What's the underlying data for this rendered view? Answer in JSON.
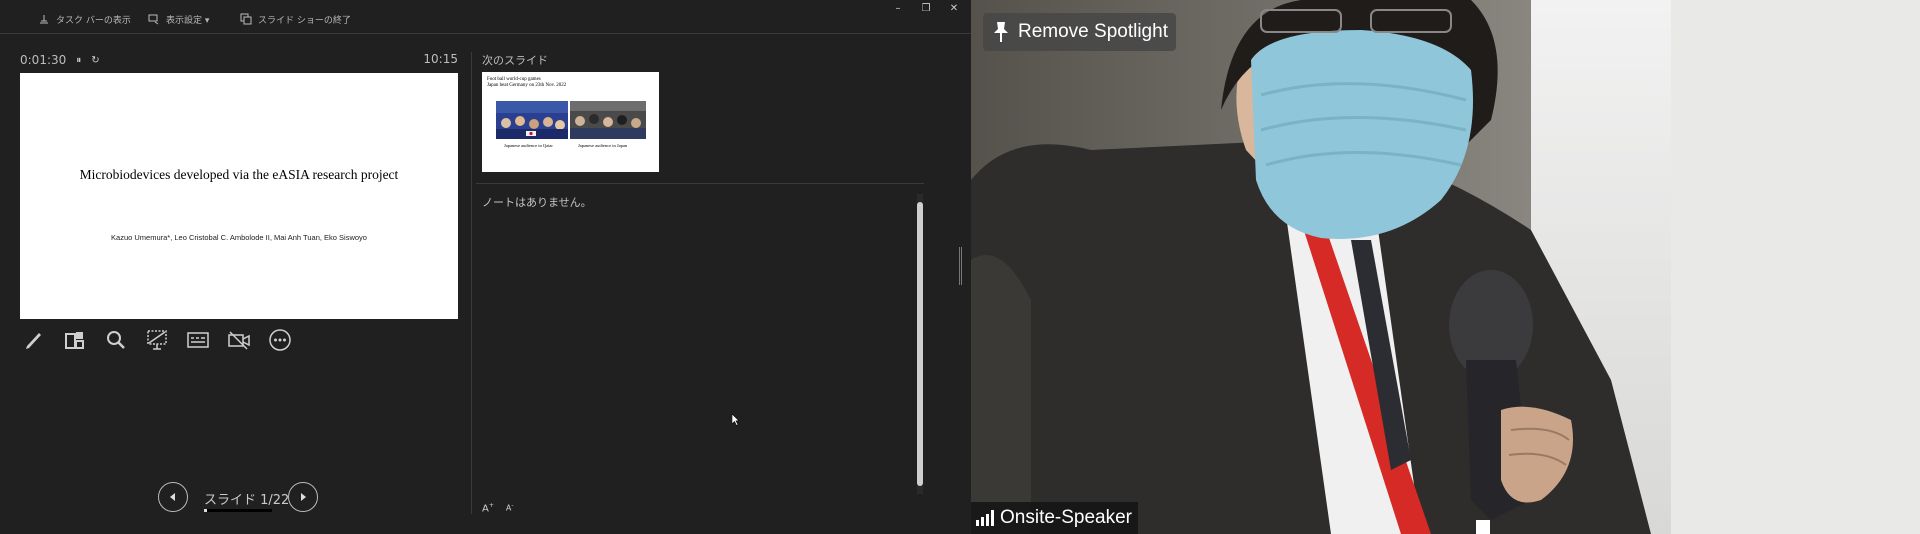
{
  "topbar": {
    "items": [
      {
        "label": "タスク バーの表示",
        "icon": "taskbar-icon"
      },
      {
        "label": "表示設定 ▾",
        "icon": "display-settings-icon"
      },
      {
        "label": "スライド ショーの終了",
        "icon": "end-slideshow-icon"
      }
    ],
    "window_controls": [
      "minimize-icon",
      "restore-icon",
      "close-icon"
    ]
  },
  "timer": {
    "elapsed": "0:01:30",
    "pause_glyph": "⏸",
    "reset_glyph": "↻",
    "clock": "10:15"
  },
  "current_slide": {
    "title": "Microbiodevices developed via the eASIA research project",
    "authors": "Kazuo Umemura*, Leo Cristobal C. Ambolode II, Mai Anh Tuan, Eko Siswoyo"
  },
  "tools": [
    "pen-icon",
    "all-slides-icon",
    "zoom-icon",
    "black-screen-icon",
    "subtitles-icon",
    "camera-off-icon",
    "more-options-icon"
  ],
  "navigation": {
    "counter": "スライド 1/22",
    "progress": 0.045
  },
  "next_slide": {
    "label": "次のスライド",
    "caption_line1": "Foot ball world-cup games",
    "caption_line2": "Japan beat Germany on 23th Nov. 2022",
    "image1_caption": "Japanese audience in Qatar",
    "image2_caption": "Japanese audience in Japan"
  },
  "notes": {
    "text": "ノートはありません。",
    "font_increase": "A",
    "font_decrease": "A"
  },
  "video": {
    "spotlight_label": "Remove Spotlight",
    "speaker_name": "Onsite-Speaker",
    "colors": {
      "jacket": "#2e2d2b",
      "background": "#6f6c65",
      "mask": "#8fc6d9",
      "lanyard": "#d62a26"
    }
  }
}
